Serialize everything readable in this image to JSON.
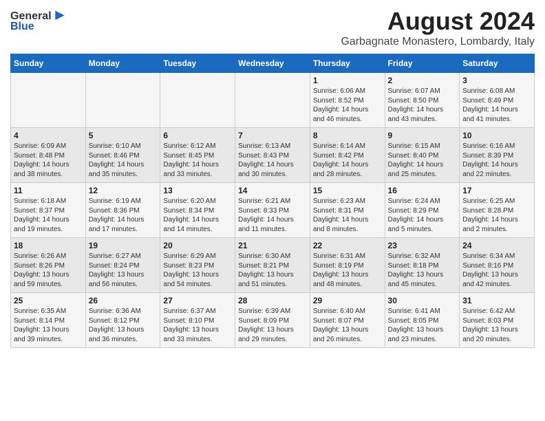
{
  "logo": {
    "text_general": "General",
    "text_blue": "Blue"
  },
  "header": {
    "title": "August 2024",
    "subtitle": "Garbagnate Monastero, Lombardy, Italy"
  },
  "weekdays": [
    "Sunday",
    "Monday",
    "Tuesday",
    "Wednesday",
    "Thursday",
    "Friday",
    "Saturday"
  ],
  "weeks": [
    [
      {
        "day": "",
        "detail": ""
      },
      {
        "day": "",
        "detail": ""
      },
      {
        "day": "",
        "detail": ""
      },
      {
        "day": "",
        "detail": ""
      },
      {
        "day": "1",
        "detail": "Sunrise: 6:06 AM\nSunset: 8:52 PM\nDaylight: 14 hours\nand 46 minutes."
      },
      {
        "day": "2",
        "detail": "Sunrise: 6:07 AM\nSunset: 8:50 PM\nDaylight: 14 hours\nand 43 minutes."
      },
      {
        "day": "3",
        "detail": "Sunrise: 6:08 AM\nSunset: 8:49 PM\nDaylight: 14 hours\nand 41 minutes."
      }
    ],
    [
      {
        "day": "4",
        "detail": "Sunrise: 6:09 AM\nSunset: 8:48 PM\nDaylight: 14 hours\nand 38 minutes."
      },
      {
        "day": "5",
        "detail": "Sunrise: 6:10 AM\nSunset: 8:46 PM\nDaylight: 14 hours\nand 35 minutes."
      },
      {
        "day": "6",
        "detail": "Sunrise: 6:12 AM\nSunset: 8:45 PM\nDaylight: 14 hours\nand 33 minutes."
      },
      {
        "day": "7",
        "detail": "Sunrise: 6:13 AM\nSunset: 8:43 PM\nDaylight: 14 hours\nand 30 minutes."
      },
      {
        "day": "8",
        "detail": "Sunrise: 6:14 AM\nSunset: 8:42 PM\nDaylight: 14 hours\nand 28 minutes."
      },
      {
        "day": "9",
        "detail": "Sunrise: 6:15 AM\nSunset: 8:40 PM\nDaylight: 14 hours\nand 25 minutes."
      },
      {
        "day": "10",
        "detail": "Sunrise: 6:16 AM\nSunset: 8:39 PM\nDaylight: 14 hours\nand 22 minutes."
      }
    ],
    [
      {
        "day": "11",
        "detail": "Sunrise: 6:18 AM\nSunset: 8:37 PM\nDaylight: 14 hours\nand 19 minutes."
      },
      {
        "day": "12",
        "detail": "Sunrise: 6:19 AM\nSunset: 8:36 PM\nDaylight: 14 hours\nand 17 minutes."
      },
      {
        "day": "13",
        "detail": "Sunrise: 6:20 AM\nSunset: 8:34 PM\nDaylight: 14 hours\nand 14 minutes."
      },
      {
        "day": "14",
        "detail": "Sunrise: 6:21 AM\nSunset: 8:33 PM\nDaylight: 14 hours\nand 11 minutes."
      },
      {
        "day": "15",
        "detail": "Sunrise: 6:23 AM\nSunset: 8:31 PM\nDaylight: 14 hours\nand 8 minutes."
      },
      {
        "day": "16",
        "detail": "Sunrise: 6:24 AM\nSunset: 8:29 PM\nDaylight: 14 hours\nand 5 minutes."
      },
      {
        "day": "17",
        "detail": "Sunrise: 6:25 AM\nSunset: 8:28 PM\nDaylight: 14 hours\nand 2 minutes."
      }
    ],
    [
      {
        "day": "18",
        "detail": "Sunrise: 6:26 AM\nSunset: 8:26 PM\nDaylight: 13 hours\nand 59 minutes."
      },
      {
        "day": "19",
        "detail": "Sunrise: 6:27 AM\nSunset: 8:24 PM\nDaylight: 13 hours\nand 56 minutes."
      },
      {
        "day": "20",
        "detail": "Sunrise: 6:29 AM\nSunset: 8:23 PM\nDaylight: 13 hours\nand 54 minutes."
      },
      {
        "day": "21",
        "detail": "Sunrise: 6:30 AM\nSunset: 8:21 PM\nDaylight: 13 hours\nand 51 minutes."
      },
      {
        "day": "22",
        "detail": "Sunrise: 6:31 AM\nSunset: 8:19 PM\nDaylight: 13 hours\nand 48 minutes."
      },
      {
        "day": "23",
        "detail": "Sunrise: 6:32 AM\nSunset: 8:18 PM\nDaylight: 13 hours\nand 45 minutes."
      },
      {
        "day": "24",
        "detail": "Sunrise: 6:34 AM\nSunset: 8:16 PM\nDaylight: 13 hours\nand 42 minutes."
      }
    ],
    [
      {
        "day": "25",
        "detail": "Sunrise: 6:35 AM\nSunset: 8:14 PM\nDaylight: 13 hours\nand 39 minutes."
      },
      {
        "day": "26",
        "detail": "Sunrise: 6:36 AM\nSunset: 8:12 PM\nDaylight: 13 hours\nand 36 minutes."
      },
      {
        "day": "27",
        "detail": "Sunrise: 6:37 AM\nSunset: 8:10 PM\nDaylight: 13 hours\nand 33 minutes."
      },
      {
        "day": "28",
        "detail": "Sunrise: 6:39 AM\nSunset: 8:09 PM\nDaylight: 13 hours\nand 29 minutes."
      },
      {
        "day": "29",
        "detail": "Sunrise: 6:40 AM\nSunset: 8:07 PM\nDaylight: 13 hours\nand 26 minutes."
      },
      {
        "day": "30",
        "detail": "Sunrise: 6:41 AM\nSunset: 8:05 PM\nDaylight: 13 hours\nand 23 minutes."
      },
      {
        "day": "31",
        "detail": "Sunrise: 6:42 AM\nSunset: 8:03 PM\nDaylight: 13 hours\nand 20 minutes."
      }
    ]
  ]
}
